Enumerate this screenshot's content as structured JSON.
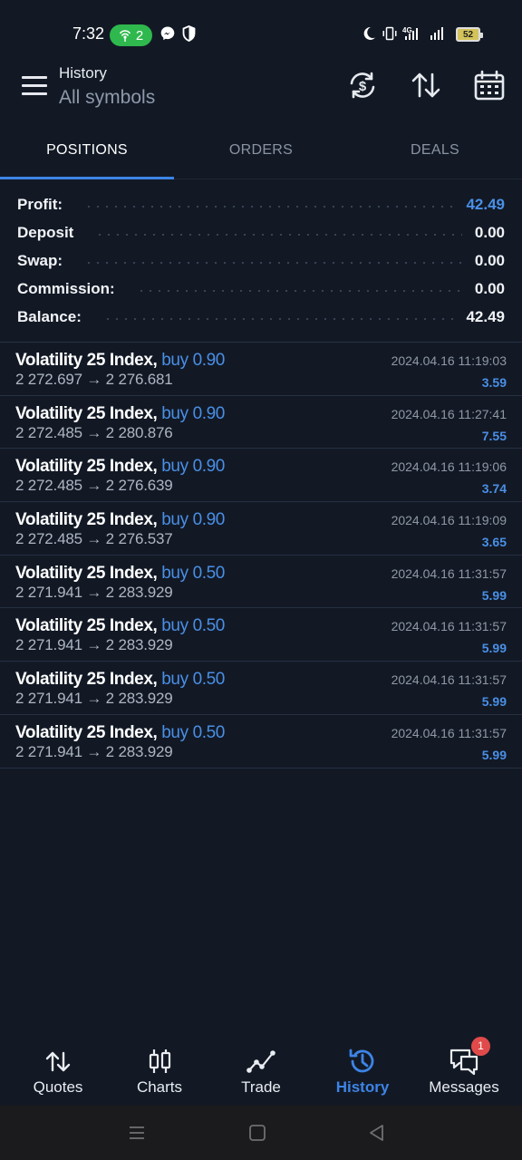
{
  "status_bar": {
    "time": "7:32",
    "hotspot_count": "2",
    "network": "4G",
    "battery": "52"
  },
  "header": {
    "title": "History",
    "subtitle": "All symbols",
    "icons": [
      "sync-currency-icon",
      "sort-icon",
      "calendar-icon"
    ]
  },
  "tabs": [
    {
      "label": "POSITIONS",
      "active": true
    },
    {
      "label": "ORDERS",
      "active": false
    },
    {
      "label": "DEALS",
      "active": false
    }
  ],
  "summary": {
    "profit_label": "Profit:",
    "profit_value": "42.49",
    "deposit_label": "Deposit",
    "deposit_value": "0.00",
    "swap_label": "Swap:",
    "swap_value": "0.00",
    "commission_label": "Commission:",
    "commission_value": "0.00",
    "balance_label": "Balance:",
    "balance_value": "42.49"
  },
  "deals": [
    {
      "symbol": "Volatility 25 Index,",
      "side": "buy 0.90",
      "prices": "2 272.697 → 2 276.681",
      "time": "2024.04.16 11:19:03",
      "profit": "3.59"
    },
    {
      "symbol": "Volatility 25 Index,",
      "side": "buy 0.90",
      "prices": "2 272.485 → 2 280.876",
      "time": "2024.04.16 11:27:41",
      "profit": "7.55"
    },
    {
      "symbol": "Volatility 25 Index,",
      "side": "buy 0.90",
      "prices": "2 272.485 → 2 276.639",
      "time": "2024.04.16 11:19:06",
      "profit": "3.74"
    },
    {
      "symbol": "Volatility 25 Index,",
      "side": "buy 0.90",
      "prices": "2 272.485 → 2 276.537",
      "time": "2024.04.16 11:19:09",
      "profit": "3.65"
    },
    {
      "symbol": "Volatility 25 Index,",
      "side": "buy 0.50",
      "prices": "2 271.941 → 2 283.929",
      "time": "2024.04.16 11:31:57",
      "profit": "5.99"
    },
    {
      "symbol": "Volatility 25 Index,",
      "side": "buy 0.50",
      "prices": "2 271.941 → 2 283.929",
      "time": "2024.04.16 11:31:57",
      "profit": "5.99"
    },
    {
      "symbol": "Volatility 25 Index,",
      "side": "buy 0.50",
      "prices": "2 271.941 → 2 283.929",
      "time": "2024.04.16 11:31:57",
      "profit": "5.99"
    },
    {
      "symbol": "Volatility 25 Index,",
      "side": "buy 0.50",
      "prices": "2 271.941 → 2 283.929",
      "time": "2024.04.16 11:31:57",
      "profit": "5.99"
    }
  ],
  "bottom_nav": [
    {
      "label": "Quotes",
      "icon": "quotes-icon"
    },
    {
      "label": "Charts",
      "icon": "charts-icon"
    },
    {
      "label": "Trade",
      "icon": "trade-icon"
    },
    {
      "label": "History",
      "icon": "history-icon",
      "active": true
    },
    {
      "label": "Messages",
      "icon": "messages-icon",
      "badge": "1"
    }
  ],
  "colors": {
    "background": "#121925",
    "accent": "#3d84e6",
    "profit_blue": "#4a8fe6",
    "badge_red": "#e04a4a"
  }
}
